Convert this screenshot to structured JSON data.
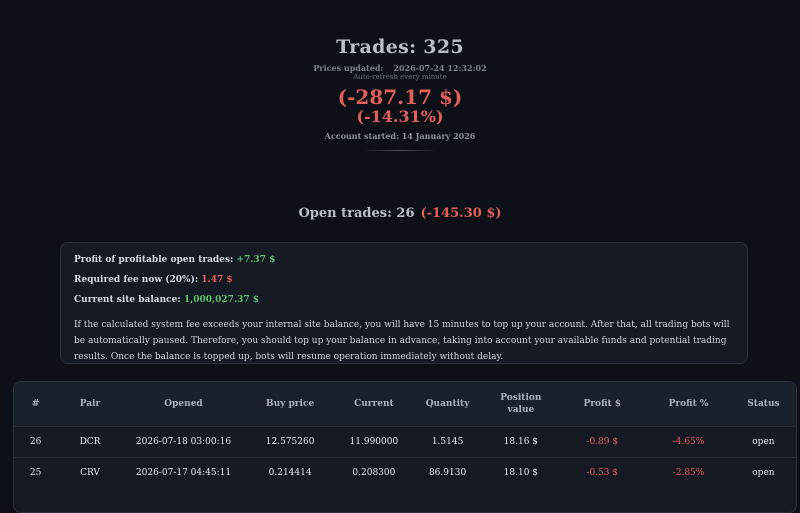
{
  "header": {
    "title": "Trades: 325",
    "prices_updated_label": "Prices updated:",
    "prices_updated_time": "2026-07-24 12:32:02",
    "auto_refresh": "Auto-refresh every minute",
    "total_profit": "(-287.17 $)",
    "total_profit_pct": "(-14.31%)",
    "account_started": "Account started: 14 January 2026"
  },
  "open_trades": {
    "label": "Open trades: 26",
    "amount": "(-145.30 $)"
  },
  "info": {
    "profit_label": "Profit of profitable open trades:",
    "profit_value": "+7.37 $",
    "fee_label": "Required fee now (20%):",
    "fee_value": "1.47 $",
    "balance_label": "Current site balance:",
    "balance_value": "1,000,027.37 $",
    "notice": "If the calculated system fee exceeds your internal site balance, you will have 15 minutes to top up your account. After that, all trading bots will be automatically paused. Therefore, you should top up your balance in advance, taking into account your available funds and potential trading results. Once the balance is topped up, bots will resume operation immediately without delay."
  },
  "table": {
    "headers": {
      "num": "#",
      "pair": "Pair",
      "opened": "Opened",
      "buy_price": "Buy price",
      "current": "Current",
      "quantity": "Quantity",
      "position_value_1": "Position",
      "position_value_2": "value",
      "profit_usd": "Profit $",
      "profit_pct": "Profit %",
      "status": "Status"
    },
    "rows": [
      {
        "num": "26",
        "pair": "DCR",
        "opened": "2026-07-18 03:00:16",
        "buy_price": "12.575260",
        "current": "11.990000",
        "quantity": "1.5145",
        "position_value": "18.16 $",
        "profit_usd": "-0.89 $",
        "profit_pct": "-4.65%",
        "status": "open"
      },
      {
        "num": "25",
        "pair": "CRV",
        "opened": "2026-07-17 04:45:11",
        "buy_price": "0.214414",
        "current": "0.208300",
        "quantity": "86.9130",
        "position_value": "18.10 $",
        "profit_usd": "-0.53 $",
        "profit_pct": "-2.85%",
        "status": "open"
      }
    ]
  },
  "colors": {
    "background": "#0d1017",
    "negative": "#e2605a",
    "positive": "#5cc06f"
  }
}
